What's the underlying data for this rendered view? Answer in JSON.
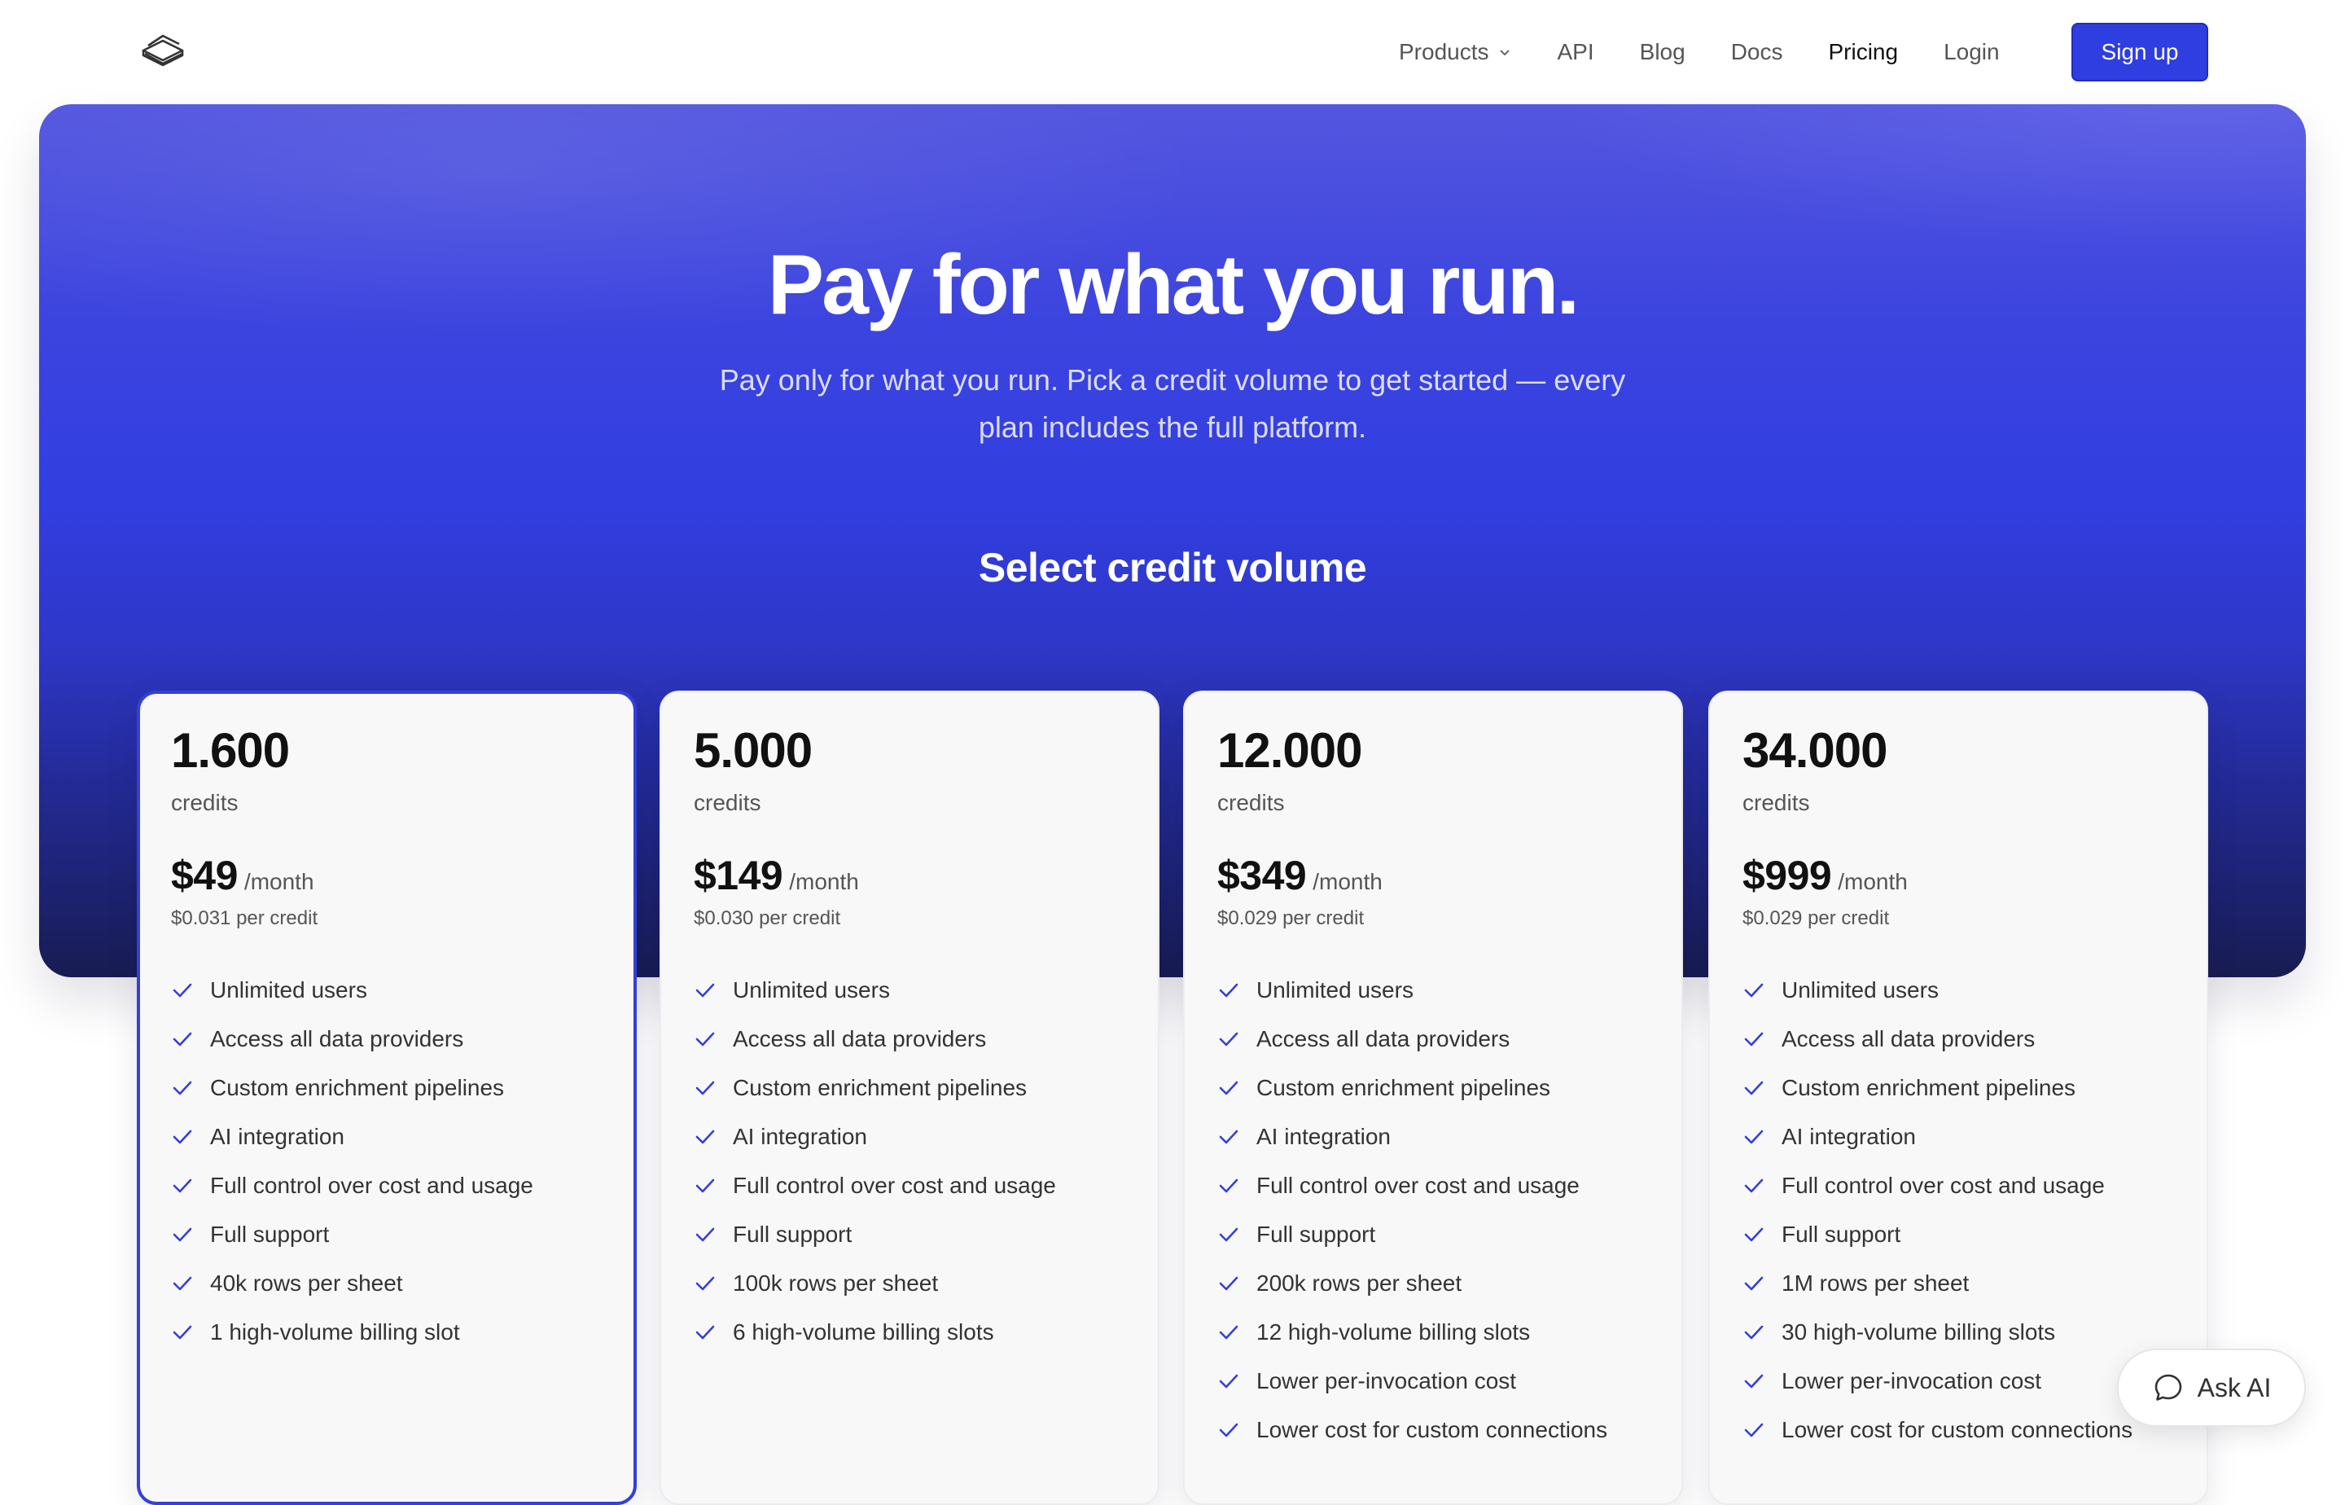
{
  "nav": {
    "logo_icon": "stacked-layers-logo-icon",
    "links": [
      {
        "label": "Products",
        "has_dropdown": true
      },
      {
        "label": "API"
      },
      {
        "label": "Blog"
      },
      {
        "label": "Docs"
      }
    ],
    "right_links": [
      {
        "label": "Pricing",
        "active": true
      },
      {
        "label": "Login"
      }
    ],
    "signup_label": "Sign up"
  },
  "hero": {
    "title": "Pay for what you run.",
    "subtitle": "Pay only for what you run. Pick a credit volume to get started — every plan includes the full platform.",
    "section_title": "Select credit volume"
  },
  "plans": [
    {
      "credits": "1.600",
      "credits_label": "credits",
      "price": "$49",
      "period": "/month",
      "per_credit": "$0.031 per credit",
      "selected": true,
      "features": [
        "Unlimited users",
        "Access all data providers",
        "Custom enrichment pipelines",
        "AI integration",
        "Full control over cost and usage",
        "Full support",
        "40k rows per sheet",
        "1 high-volume billing slot"
      ]
    },
    {
      "credits": "5.000",
      "credits_label": "credits",
      "price": "$149",
      "period": "/month",
      "per_credit": "$0.030 per credit",
      "selected": false,
      "features": [
        "Unlimited users",
        "Access all data providers",
        "Custom enrichment pipelines",
        "AI integration",
        "Full control over cost and usage",
        "Full support",
        "100k rows per sheet",
        "6 high-volume billing slots"
      ]
    },
    {
      "credits": "12.000",
      "credits_label": "credits",
      "price": "$349",
      "period": "/month",
      "per_credit": "$0.029 per credit",
      "selected": false,
      "features": [
        "Unlimited users",
        "Access all data providers",
        "Custom enrichment pipelines",
        "AI integration",
        "Full control over cost and usage",
        "Full support",
        "200k rows per sheet",
        "12 high-volume billing slots",
        "Lower per-invocation cost",
        "Lower cost for custom connections"
      ]
    },
    {
      "credits": "34.000",
      "credits_label": "credits",
      "price": "$999",
      "period": "/month",
      "per_credit": "$0.029 per credit",
      "selected": false,
      "features": [
        "Unlimited users",
        "Access all data providers",
        "Custom enrichment pipelines",
        "AI integration",
        "Full control over cost and usage",
        "Full support",
        "1M rows per sheet",
        "30 high-volume billing slots",
        "Lower per-invocation cost",
        "Lower cost for custom connections"
      ]
    }
  ],
  "ask_ai": {
    "label": "Ask AI",
    "icon": "chat-bubble-icon"
  },
  "colors": {
    "accent": "#2f3ee0",
    "check": "#3440d8",
    "hero_top": "#5356df",
    "hero_bottom": "#181c52"
  }
}
